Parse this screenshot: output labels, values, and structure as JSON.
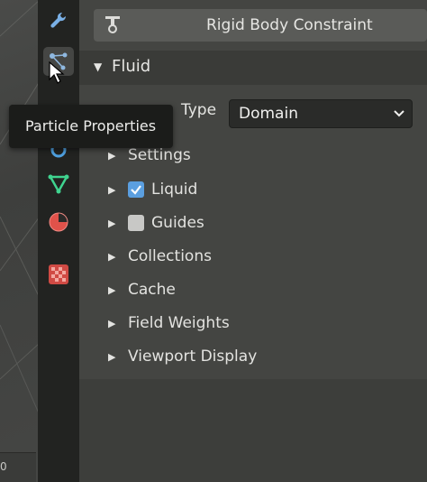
{
  "viewport": {
    "footer_value": "0"
  },
  "tabs": [
    {
      "name": "tool-tab",
      "icon": "wrench-icon"
    },
    {
      "name": "particles-tab",
      "icon": "particles-icon"
    },
    {
      "name": "physics-tab",
      "icon": "physics-icon"
    },
    {
      "name": "object-data-tab",
      "icon": "mesh-data-icon"
    },
    {
      "name": "material-tab",
      "icon": "material-icon"
    },
    {
      "name": "texture-tab",
      "icon": "texture-icon"
    }
  ],
  "header": {
    "constraint_label": "Rigid Body Constraint"
  },
  "fluid": {
    "title": "Fluid",
    "type_label": "Type",
    "type_value": "Domain",
    "settings_label": "Settings",
    "liquid_label": "Liquid",
    "liquid_checked": true,
    "guides_label": "Guides",
    "guides_checked": false,
    "collections_label": "Collections",
    "cache_label": "Cache",
    "field_weights_label": "Field Weights",
    "viewport_display_label": "Viewport Display"
  },
  "tooltip": {
    "text": "Particle Properties"
  },
  "colors": {
    "accent_blue": "#5b9fe0",
    "wrench_blue": "#7ab0e6",
    "mesh_green": "#3fd38f",
    "material_red": "#e0524a",
    "texture_red": "#d04a44"
  }
}
